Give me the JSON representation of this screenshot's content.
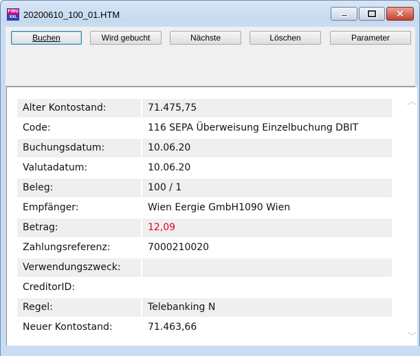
{
  "window": {
    "title": "20200610_100_01.HTM",
    "icon": "fibu-app-icon",
    "icon_text_top": "FIBU",
    "icon_text_bottom": "XXL",
    "controls": {
      "minimize": "minimize-icon",
      "maximize": "maximize-icon",
      "close": "close-icon"
    }
  },
  "toolbar": {
    "buttons": [
      {
        "label": "Buchen"
      },
      {
        "label": "Wird gebucht"
      },
      {
        "label": "Nächste"
      },
      {
        "label": "Löschen"
      },
      {
        "label": "Parameter"
      }
    ]
  },
  "details": {
    "rows": [
      {
        "label": "Alter Kontostand:",
        "value": "71.475,75"
      },
      {
        "label": "Code:",
        "value": "116 SEPA Überweisung Einzelbuchung DBIT"
      },
      {
        "label": "Buchungsdatum:",
        "value": "10.06.20"
      },
      {
        "label": "Valutadatum:",
        "value": "10.06.20"
      },
      {
        "label": "Beleg:",
        "value": "100 / 1"
      },
      {
        "label": "Empfänger:",
        "value": "Wien Eergie GmbH1090 Wien"
      },
      {
        "label": "Betrag:",
        "value": "12,09"
      },
      {
        "label": "Zahlungsreferenz:",
        "value": "7000210020"
      },
      {
        "label": "Verwendungszweck:",
        "value": ""
      },
      {
        "label": "CreditorID:",
        "value": ""
      },
      {
        "label": "Regel:",
        "value": "Telebanking N"
      },
      {
        "label": "Neuer Kontostand:",
        "value": "71.463,66"
      }
    ]
  },
  "colors": {
    "amount": "#e0001b",
    "row_shade": "#efefef",
    "frame": "#c9dcf1"
  },
  "scrollbar": {
    "up": "chevron-up-icon",
    "down": "chevron-down-icon"
  }
}
